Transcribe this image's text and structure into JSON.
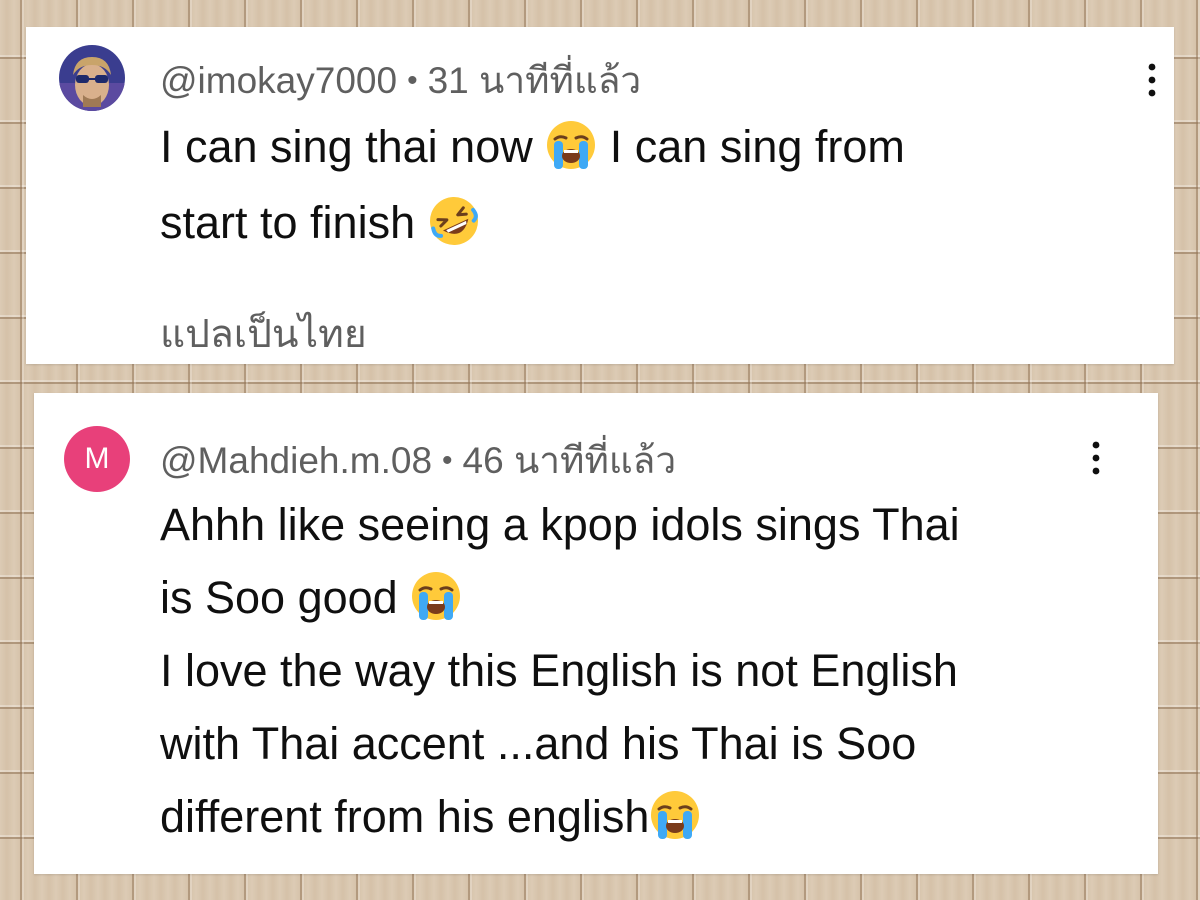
{
  "comments": [
    {
      "handle": "@imokay7000",
      "separator": "•",
      "time": "31 นาทีที่แล้ว",
      "text_line1_a": "I can sing thai now",
      "text_line1_b": "I can sing from",
      "text_line2": "start to finish",
      "emoji_1": "loudly-crying-face-emoji",
      "emoji_2": "rolling-on-floor-laughing-emoji",
      "translate_label": "แปลเป็นไทย",
      "avatar_icon": "user-photo-avatar"
    },
    {
      "handle": "@Mahdieh.m.08",
      "separator": "•",
      "time": "46 นาทีที่แล้ว",
      "avatar_letter": "M",
      "avatar_color": "#e8407a",
      "text_line1": "Ahhh like seeing a kpop idols sings Thai",
      "text_line2": "is Soo good",
      "text_line3": "I love the way this English is not English",
      "text_line4": "with Thai accent ...and his Thai is Soo",
      "text_line5": "different from his english",
      "emoji_1": "loudly-crying-face-emoji",
      "emoji_2": "loudly-crying-face-emoji"
    }
  ],
  "icons": {
    "more": "more-vertical-icon"
  }
}
